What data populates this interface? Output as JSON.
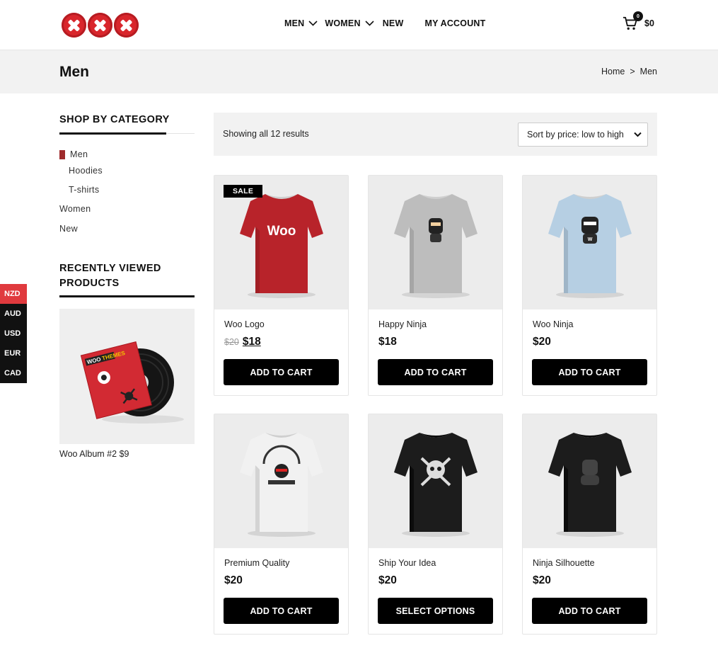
{
  "header": {
    "logo_alt": "XXX",
    "nav": [
      {
        "label": "MEN"
      },
      {
        "label": "WOMEN"
      },
      {
        "label": "NEW"
      },
      {
        "label": "MY ACCOUNT"
      }
    ],
    "cart_count": "0",
    "cart_total": "$0"
  },
  "title_bar": {
    "title": "Men",
    "breadcrumb": {
      "home": "Home",
      "separator": ">",
      "current": "Men"
    }
  },
  "sidebar": {
    "category_title": "SHOP BY CATEGORY",
    "categories": [
      {
        "label": "Men"
      },
      {
        "label": "Hoodies"
      },
      {
        "label": "T-shirts"
      },
      {
        "label": "Women"
      },
      {
        "label": "New"
      }
    ],
    "recent_title_line1": "RECENTLY VIEWED",
    "recent_title_line2": "PRODUCTS",
    "recent_product": {
      "name": "Woo Album #2",
      "price": "$9"
    }
  },
  "currency": {
    "options": [
      "NZD",
      "AUD",
      "USD",
      "EUR",
      "CAD"
    ],
    "active": "NZD"
  },
  "toolbar": {
    "result_count": "Showing all 12 results",
    "sort_selected": "Sort by price: low to high"
  },
  "products": [
    {
      "name": "Woo Logo",
      "old_price": "$20",
      "price": "$18",
      "button": "ADD TO CART",
      "badge": "SALE",
      "shirt_color": "#b8232a"
    },
    {
      "name": "Happy Ninja",
      "price": "$18",
      "button": "ADD TO CART",
      "shirt_color": "#bdbdbd"
    },
    {
      "name": "Woo Ninja",
      "price": "$20",
      "button": "ADD TO CART",
      "shirt_color": "#b6cfe3"
    },
    {
      "name": "Premium Quality",
      "price": "$20",
      "button": "ADD TO CART",
      "shirt_color": "#f1f1f1"
    },
    {
      "name": "Ship Your Idea",
      "price": "$20",
      "button": "SELECT OPTIONS",
      "shirt_color": "#1c1c1c"
    },
    {
      "name": "Ninja Silhouette",
      "price": "$20",
      "button": "ADD TO CART",
      "shirt_color": "#1c1c1c"
    }
  ],
  "colors": {
    "accent": "#e03a3e",
    "brand_red": "#d9262c",
    "button": "#000000",
    "panel": "#f2f2f2"
  }
}
